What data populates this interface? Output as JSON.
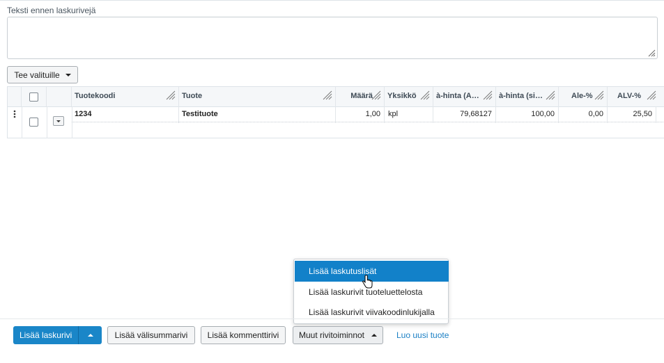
{
  "invoice": {
    "text_before_label": "Teksti ennen laskurivejä",
    "text_before_value": ""
  },
  "bulk_actions": {
    "label": "Tee valituille"
  },
  "table": {
    "columns": [
      "Tuotekoodi",
      "Tuote",
      "Määrä",
      "Yksikkö",
      "à-hinta (A…",
      "à-hinta (si…",
      "Ale-%",
      "ALV-%"
    ],
    "rows": [
      {
        "code": "1234",
        "product": "Testituote",
        "quantity": "1,00",
        "unit": "kpl",
        "price_a": "79,68127",
        "price_si": "100,00",
        "discount": "0,00",
        "vat": "25,50"
      }
    ]
  },
  "dropdown_menu": {
    "items": [
      "Lisää laskutuslisät",
      "Lisää laskurivit tuoteluettelosta",
      "Lisää laskurivit viivakoodinlukijalla"
    ],
    "active_index": 0
  },
  "footer": {
    "add_row_label": "Lisää laskurivi",
    "add_subtotal_label": "Lisää välisummarivi",
    "add_comment_label": "Lisää kommenttirivi",
    "other_actions_label": "Muut rivitoiminnot",
    "new_product_link": "Luo uusi tuote"
  },
  "colors": {
    "primary": "#1a86c8",
    "menu_active": "#1281c9",
    "link": "#1a7fc4"
  }
}
